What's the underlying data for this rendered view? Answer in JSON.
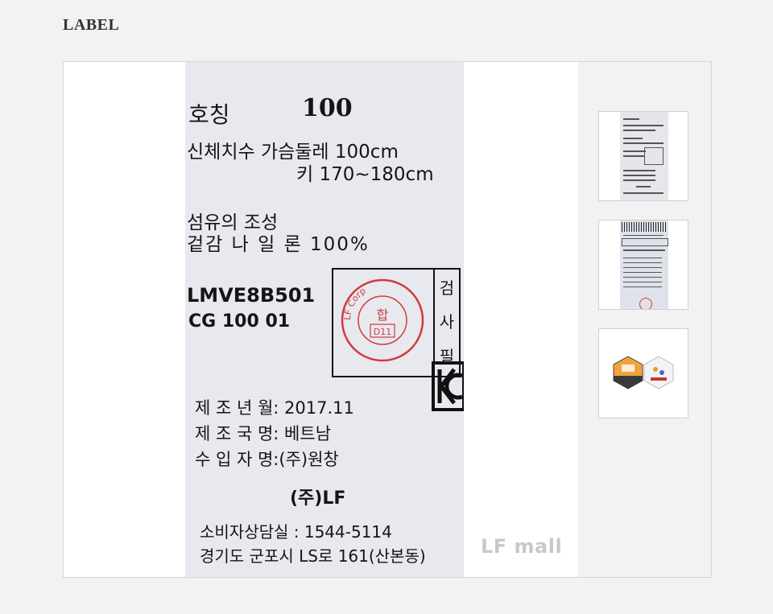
{
  "page": {
    "section_title": "LABEL"
  },
  "label": {
    "size_label": "호칭",
    "size_value": "100",
    "body_line1": "신체치수 가슴둘레   100cm",
    "body_line2": "키 170~180cm",
    "fiber_heading": "섬유의 조성",
    "fiber_line": "겉감 나  일  론 100%",
    "code1": "LMVE8B501",
    "code2": "CG 100 01",
    "inspection": [
      "검",
      "사",
      "필"
    ],
    "stamp_ring": "LF Corp",
    "stamp_center": "합",
    "stamp_code": "D11",
    "mfg_date": "제 조 년 월: 2017.11",
    "country": "제 조 국 명: 베트남",
    "importer": "수 입 자 명:(주)원창",
    "brand": "(주)LF",
    "cs": "소비자상담실 : 1544-5114",
    "address": "경기도 군포시 LS로 161(산본동)"
  },
  "watermark": "LF mall",
  "thumbnails": [
    {
      "name": "label-front-thumbnail"
    },
    {
      "name": "label-care-thumbnail"
    },
    {
      "name": "certification-badges-thumbnail"
    }
  ],
  "colors": {
    "background": "#f2f2f2",
    "label_paper": "#e7e9ef",
    "stamp_red": "#d23a3a"
  }
}
